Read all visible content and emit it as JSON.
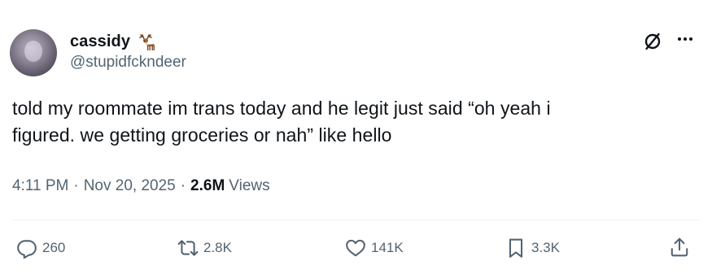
{
  "author": {
    "display_name": "cassidy",
    "emoji_icon": "deer-icon",
    "handle": "@stupidfckndeer"
  },
  "header_icons": {
    "grok": "grok-icon",
    "more": "more-icon"
  },
  "tweet": {
    "text": "told my roommate im trans today and he legit just said “oh yeah i\nfigured. we getting groceries or nah” like hello"
  },
  "meta": {
    "time": "4:11 PM",
    "separator": "·",
    "date": "Nov 20, 2025",
    "views_count": "2.6M",
    "views_label": "Views"
  },
  "actions": {
    "reply": {
      "icon": "reply-icon",
      "count": "260"
    },
    "repost": {
      "icon": "repost-icon",
      "count": "2.8K"
    },
    "like": {
      "icon": "heart-icon",
      "count": "141K"
    },
    "bookmark": {
      "icon": "bookmark-icon",
      "count": "3.3K"
    },
    "share": {
      "icon": "share-icon"
    }
  },
  "colors": {
    "text": "#0f1419",
    "secondary": "#536471",
    "divider": "#eff3f4",
    "background": "#ffffff"
  }
}
